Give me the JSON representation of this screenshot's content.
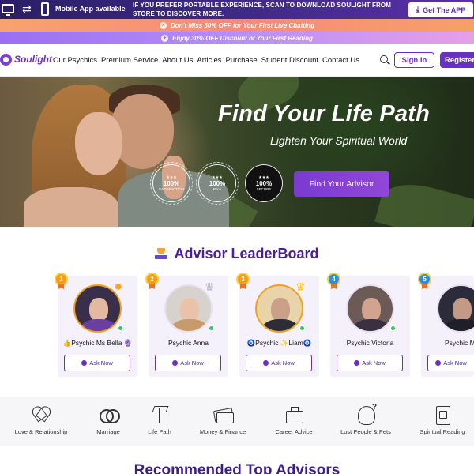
{
  "appbar": {
    "mobile_label": "Mobile App available",
    "promo_text": "IF YOU PREFER PORTABLE EXPERIENCE, SCAN TO DOWNLOAD SOULIGHT FROM STORE TO DISCOVER MORE.",
    "get_app_label": "Get The APP"
  },
  "strips": {
    "first": "Don't Miss 50% OFF for Your First Live Chatting",
    "second": "Enjoy 30% OFF Discount of Your First Reading"
  },
  "nav": {
    "logo": "Soulight",
    "links": [
      "Our Psychics",
      "Premium Service",
      "About Us",
      "Articles",
      "Purchase",
      "Student Discount",
      "Contact Us"
    ],
    "signin": "Sign In",
    "register": "Register"
  },
  "hero": {
    "title": "Find Your Life Path",
    "subtitle": "Lighten Your Spiritual World",
    "badges": [
      {
        "num": "100%",
        "cap": "SATISFACTION"
      },
      {
        "num": "100%",
        "cap": "Price"
      },
      {
        "num": "100%",
        "cap": "SECURE"
      }
    ],
    "cta": "Find Your Advisor"
  },
  "leaderboard": {
    "title": "Advisor LeaderBoard",
    "ask_label": "Ask Now",
    "advisors": [
      {
        "rank": "1",
        "name": "👍Psychic Ms Bella 🔮"
      },
      {
        "rank": "2",
        "name": "Psychic Anna"
      },
      {
        "rank": "3",
        "name": "🧿Psychic ✨Liam🧿"
      },
      {
        "rank": "4",
        "name": "Psychic Victoria"
      },
      {
        "rank": "5",
        "name": "Psychic M"
      }
    ]
  },
  "categories": [
    "Love & Relationship",
    "Marriage",
    "Life Path",
    "Money & Finance",
    "Career Advice",
    "Lost People & Pets",
    "Spiritual Reading"
  ],
  "recommended_title": "Recommended Top Advisors",
  "colors": {
    "brand_purple": "#6a2fc4",
    "title_purple": "#4a1f9e",
    "rank_gold": "#f59c1a",
    "rank_blue": "#2a8ee8",
    "online_green": "#2ecb59"
  }
}
